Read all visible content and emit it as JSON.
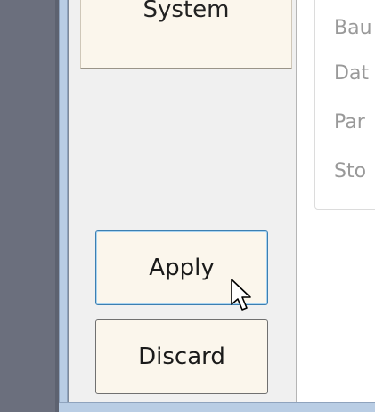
{
  "nav": {
    "top_item_label": "System"
  },
  "actions": {
    "apply_label": "Apply",
    "discard_label": "Discard"
  },
  "settings": {
    "labels": [
      "Bau",
      "Dat",
      "Par",
      "Sto"
    ]
  },
  "cursor": {
    "icon": "mouse-pointer-icon"
  }
}
